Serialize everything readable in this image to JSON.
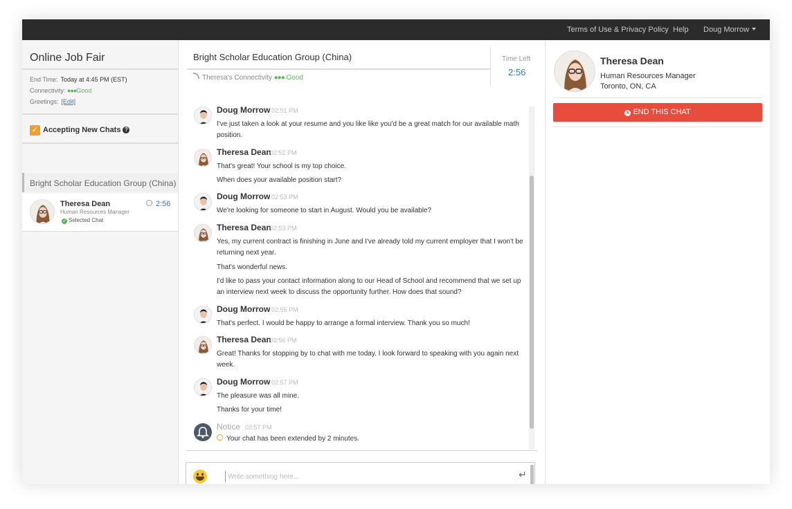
{
  "topbar": {
    "terms": "Terms of Use & Privacy Policy",
    "help": "Help",
    "user": "Doug Morrow"
  },
  "sidebar": {
    "title": "Online Job Fair",
    "end_time_label": "End Time:",
    "end_time_value": "Today at 4:45 PM (EST)",
    "connectivity_label": "Connectivity:",
    "connectivity_value": "Good",
    "greetings_label": "Greetings:",
    "greetings_edit": "[Edit]",
    "accepting_label": "Accepting New Chats",
    "accepting_checked": true,
    "group_name": "Bright Scholar Education Group (China)",
    "chat_item": {
      "name": "Theresa Dean",
      "role": "Human Resources Manager",
      "status": "Selected Chat",
      "time": "2:56"
    }
  },
  "chat": {
    "title": "Bright Scholar Education Group (China)",
    "connectivity_label": "Theresa's Connectivity",
    "connectivity_value": "Good",
    "time_left_label": "Time Left",
    "time_left_value": "2:56",
    "messages": [
      {
        "name": "Doug Morrow",
        "time": "02:51 PM",
        "lines": [
          "I've just taken a look at your resume and you like like you'd be a great match for our available math position."
        ]
      },
      {
        "name": "Theresa Dean",
        "time": "02:52 PM",
        "lines": [
          "That's great! Your school is my top choice.",
          "When does your available position start?"
        ]
      },
      {
        "name": "Doug Morrow",
        "time": "02:53 PM",
        "lines": [
          "We're looking for someone to start in August. Would you be available?"
        ]
      },
      {
        "name": "Theresa Dean",
        "time": "02:53 PM",
        "lines": [
          "Yes, my current contract is finishing in June and I've already told my current employer that I won't be returning next year.",
          "That's wonderful news.",
          "I'd like to pass your contact information along to our Head of School and recommend that we set up an interview next week to discuss the opportunity further. How does that sound?"
        ]
      },
      {
        "name": "Doug Morrow",
        "time": "02:55 PM",
        "lines": [
          "That's perfect. I would be happy to arrange a formal interview. Thank you so much!"
        ]
      },
      {
        "name": "Theresa Dean",
        "time": "02:56 PM",
        "lines": [
          "Great! Thanks for stopping by to chat with me today. I look forward to speaking with you again next week."
        ]
      },
      {
        "name": "Doug Morrow",
        "time": "02:57 PM",
        "lines": [
          "The pleasure was all mine.",
          "Thanks for your time!"
        ]
      }
    ],
    "notice": {
      "name": "Notice",
      "time": "02:57 PM",
      "text": "Your chat has been extended by 2 minutes."
    },
    "composer_placeholder": "Write something here..."
  },
  "profile": {
    "name": "Theresa Dean",
    "role": "Human Resources Manager",
    "location": "Toronto, ON, CA",
    "end_button": "END THIS CHAT"
  },
  "colors": {
    "topbar": "#2b2b2b",
    "accent_blue": "#337ab7",
    "good_green": "#5cb85c",
    "end_red": "#e74c3c",
    "checkbox_orange": "#f0a02b"
  }
}
